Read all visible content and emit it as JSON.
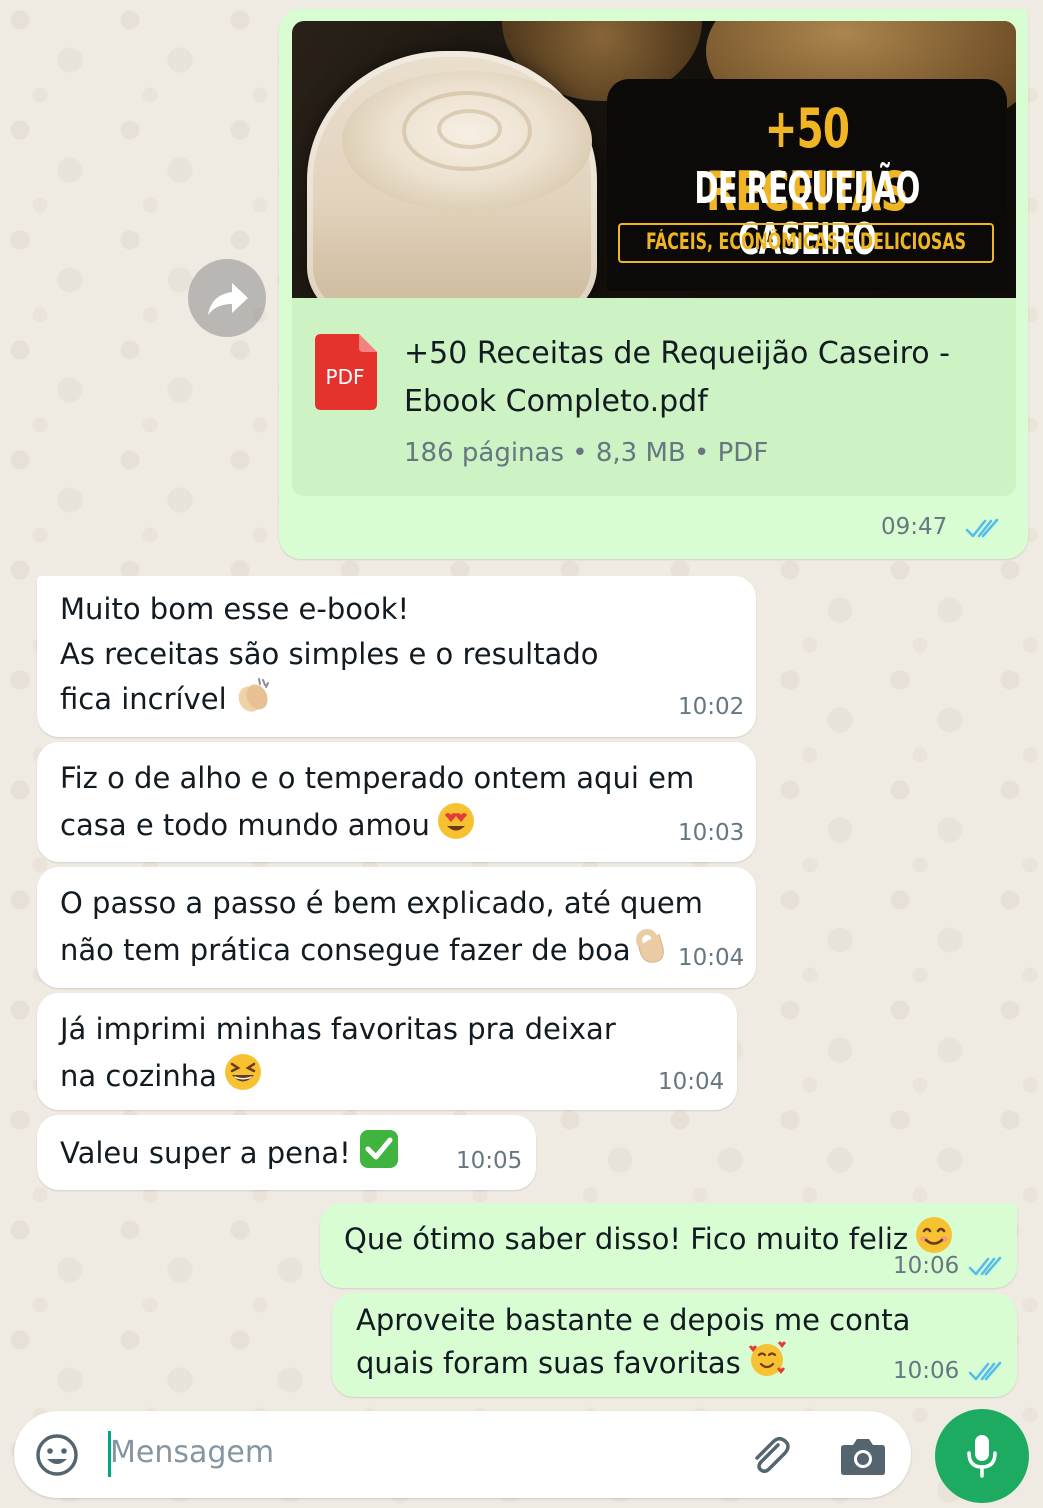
{
  "document_message": {
    "banner": {
      "title_line1": "+50 RECEITAS",
      "title_line2": "DE REQUEIJÃO CASEIRO",
      "subtitle": "FÁCEIS, ECONÔMICAS E DELICIOSAS"
    },
    "file_icon_label": "PDF",
    "file_name_line1": "+50 Receitas de Requeijão Caseiro -",
    "file_name_line2": "Ebook Completo.pdf",
    "file_meta": "186 páginas • 8,3 MB • PDF",
    "time": "09:47",
    "status": "read"
  },
  "messages": [
    {
      "direction": "in",
      "lines": [
        "Muito bom esse e-book!",
        "As receitas são simples e o resultado",
        "fica incrível"
      ],
      "emoji": "clapping-hands",
      "time": "10:02"
    },
    {
      "direction": "in",
      "lines": [
        "Fiz o de alho e o temperado ontem aqui em",
        "casa e todo mundo amou"
      ],
      "emoji": "heart-eyes",
      "time": "10:03"
    },
    {
      "direction": "in",
      "lines": [
        "O passo a passo é bem explicado, até quem",
        "não tem prática consegue fazer de boa"
      ],
      "emoji": "ok-hand",
      "time": "10:04"
    },
    {
      "direction": "in",
      "lines": [
        "Já imprimi minhas favoritas pra deixar",
        "na cozinha"
      ],
      "emoji": "grinning-squinting",
      "time": "10:04"
    },
    {
      "direction": "in",
      "lines": [
        "Valeu super a pena!"
      ],
      "emoji": "check-mark-button",
      "time": "10:05"
    },
    {
      "direction": "out",
      "lines": [
        "Que ótimo saber disso! Fico muito feliz"
      ],
      "emoji": "smiling-face",
      "time": "10:06",
      "status": "read"
    },
    {
      "direction": "out",
      "lines": [
        "Aproveite bastante e depois me conta",
        "quais foram suas favoritas"
      ],
      "emoji": "smiling-face-with-hearts",
      "time": "10:06",
      "status": "read"
    }
  ],
  "composer": {
    "placeholder": "Mensagem",
    "icons": [
      "emoji-icon",
      "attach-icon",
      "camera-icon",
      "mic-icon"
    ]
  },
  "colors": {
    "wallpaper": "#efeae2",
    "outgoing_bubble": "#d9fdd3",
    "incoming_bubble": "#ffffff",
    "read_ticks": "#53bdeb",
    "mic_button": "#1daa61",
    "pdf_red": "#e5322d",
    "banner_gold": "#f0b522"
  }
}
